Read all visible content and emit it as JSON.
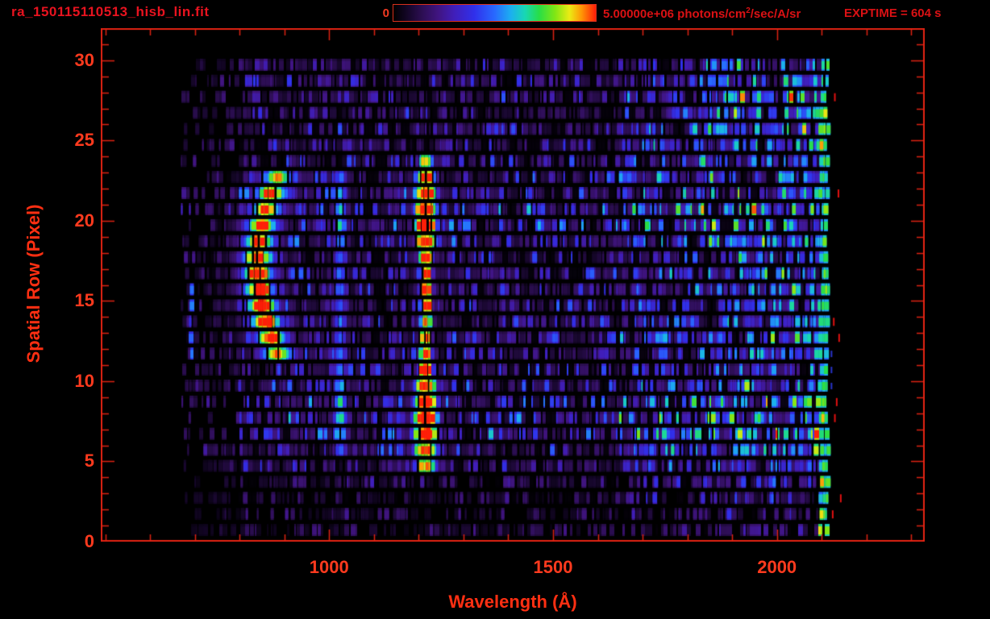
{
  "header": {
    "title": "ra_150115110513_hisb_lin.fit",
    "exptime": "EXPTIME = 604 s",
    "colorbar": {
      "min_label": "0",
      "max_value_label": "5.00000e+06",
      "units_prefix": " photons/cm",
      "units_superscript": "2",
      "units_suffix": "/sec/A/sr"
    }
  },
  "chart_data": {
    "type": "heatmap",
    "title": "ra_150115110513_hisb_lin.fit",
    "xlabel": "Wavelength (Å)",
    "ylabel": "Spatial Row (Pixel)",
    "x_tick_labels": [
      "1000",
      "1500",
      "2000"
    ],
    "x_tick_values": [
      1000,
      1500,
      2000
    ],
    "x_minor_step": 100,
    "y_tick_labels": [
      "0",
      "5",
      "10",
      "15",
      "20",
      "25",
      "30"
    ],
    "y_tick_values": [
      0,
      5,
      10,
      15,
      20,
      25,
      30
    ],
    "y_minor_step": 1,
    "xlim": [
      490,
      2330
    ],
    "ylim": [
      0,
      32
    ],
    "grid": false,
    "legend": "none",
    "spatial_rows": 31,
    "data_wavelength_range": [
      666,
      2118
    ],
    "colorbar_scale": {
      "min": 0,
      "max": 5000000,
      "units": "photons/cm2/sec/A/sr"
    },
    "exposure_time_s": 604,
    "features": [
      {
        "name": "curved-emission-arc",
        "vertex_wavelength": 841,
        "vertex_row": 17.5,
        "curvature_A_per_row2": 1.45,
        "rows": [
          12,
          23
        ],
        "halo_amp": 0.4,
        "hook_wavelength": 890,
        "hook_rows": [
          22,
          23
        ],
        "hook_amp": 0.55
      },
      {
        "name": "faint-emission-line",
        "wavelength": 1025,
        "sigma_A": 13,
        "rows": [
          6,
          23
        ]
      },
      {
        "name": "bright-emission-line",
        "wavelength": 1216,
        "rows": [
          5,
          24
        ],
        "yellow_core_rows": [
          7,
          8,
          9,
          11,
          15,
          16,
          20,
          21
        ]
      },
      {
        "name": "long-wavelength-bright-edge",
        "wavelength_range": [
          2096,
          2116
        ],
        "rows": [
          1,
          30
        ]
      },
      {
        "name": "bottom-yellow-streak",
        "wavelength_range": [
          2092,
          2102
        ],
        "rows": [
          1,
          2
        ]
      },
      {
        "name": "detached-blue-streak",
        "wavelength": 693,
        "rows": [
          12,
          16.5
        ],
        "amp": 0.5
      },
      {
        "name": "stray-red-specks",
        "wavelength_range": [
          2120,
          2145
        ],
        "rows": [
          2,
          3,
          8,
          9,
          13,
          14,
          22,
          28
        ]
      }
    ],
    "row_brightness": [
      0.25,
      0.45,
      0.5,
      0.55,
      0.6,
      0.8,
      1.0,
      1.2,
      1.25,
      1.15,
      1.0,
      0.9,
      0.92,
      0.95,
      0.9,
      0.95,
      0.9,
      0.95,
      0.9,
      1.05,
      1.15,
      1.2,
      1.15,
      1.0,
      0.9,
      0.85,
      0.9,
      0.85,
      0.9,
      0.8,
      0.75
    ],
    "arc_amp_by_row": [
      0,
      0,
      0,
      0,
      0,
      0,
      0,
      0,
      0,
      0,
      0,
      0,
      0.6,
      0.74,
      0.82,
      0.86,
      0.88,
      0.86,
      0.82,
      0.78,
      0.74,
      0.7,
      0.66,
      0.5,
      0,
      0,
      0,
      0,
      0,
      0,
      0
    ],
    "lya_amp_by_row": [
      0,
      0,
      0,
      0,
      0,
      0.6,
      0.74,
      0.82,
      0.84,
      0.8,
      0.78,
      0.8,
      0.74,
      0.72,
      0.74,
      0.78,
      0.8,
      0.78,
      0.74,
      0.8,
      0.84,
      0.82,
      0.78,
      0.72,
      0.58,
      0,
      0,
      0,
      0,
      0,
      0
    ],
    "lya_halfwidth_A": [
      0,
      0,
      0,
      0,
      0,
      22,
      25,
      27,
      27,
      25,
      22,
      16,
      13,
      12,
      12,
      13,
      14,
      14,
      16,
      21,
      24,
      24,
      23,
      20,
      15,
      0,
      0,
      0,
      0,
      0,
      0
    ],
    "lyb_amp_by_row": [
      0,
      0,
      0,
      0,
      0,
      0,
      0.32,
      0.5,
      0.55,
      0.5,
      0.4,
      0.34,
      0.36,
      0.32,
      0.33,
      0.31,
      0.31,
      0.33,
      0.32,
      0.44,
      0.48,
      0.5,
      0.46,
      0.34,
      0,
      0,
      0,
      0,
      0,
      0,
      0
    ],
    "colormap_stops": [
      [
        0.0,
        0,
        0,
        0
      ],
      [
        0.05,
        14,
        4,
        28
      ],
      [
        0.14,
        44,
        14,
        82
      ],
      [
        0.22,
        64,
        20,
        128
      ],
      [
        0.3,
        64,
        30,
        185
      ],
      [
        0.4,
        48,
        48,
        235
      ],
      [
        0.5,
        40,
        105,
        255
      ],
      [
        0.58,
        28,
        175,
        240
      ],
      [
        0.65,
        24,
        215,
        180
      ],
      [
        0.72,
        40,
        222,
        70
      ],
      [
        0.8,
        130,
        230,
        20
      ],
      [
        0.87,
        235,
        235,
        20
      ],
      [
        0.93,
        255,
        150,
        5
      ],
      [
        1.0,
        255,
        30,
        8
      ]
    ],
    "colors": {
      "frame": "#dd2212",
      "tick": "#dd2212",
      "axis_label": "#ff2f12",
      "tick_label": "#ff3a1e",
      "title_text": "#e8131f",
      "header_text": "#da1114",
      "background": "#000000"
    }
  }
}
